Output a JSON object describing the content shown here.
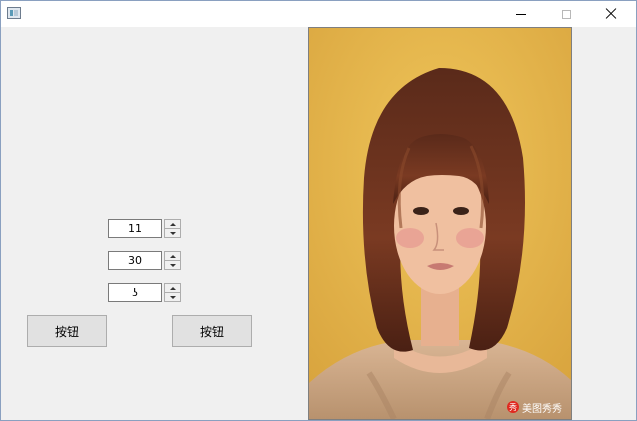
{
  "window": {
    "title": "",
    "controls": {
      "minimize": "minimize-icon",
      "maximize": "maximize-icon",
      "close": "close-icon"
    }
  },
  "spinners": [
    {
      "value": "11"
    },
    {
      "value": "30"
    },
    {
      "value": "ʖ"
    }
  ],
  "buttons": [
    {
      "label": "按钮"
    },
    {
      "label": "按钮"
    }
  ],
  "photo": {
    "watermark_logo": "秀",
    "watermark_text": "美图秀秀"
  },
  "colors": {
    "window_bg": "#f0f0f0",
    "titlebar_bg": "#ffffff",
    "photo_bg": "#e4b44a",
    "watermark_logo": "#e02a20"
  }
}
